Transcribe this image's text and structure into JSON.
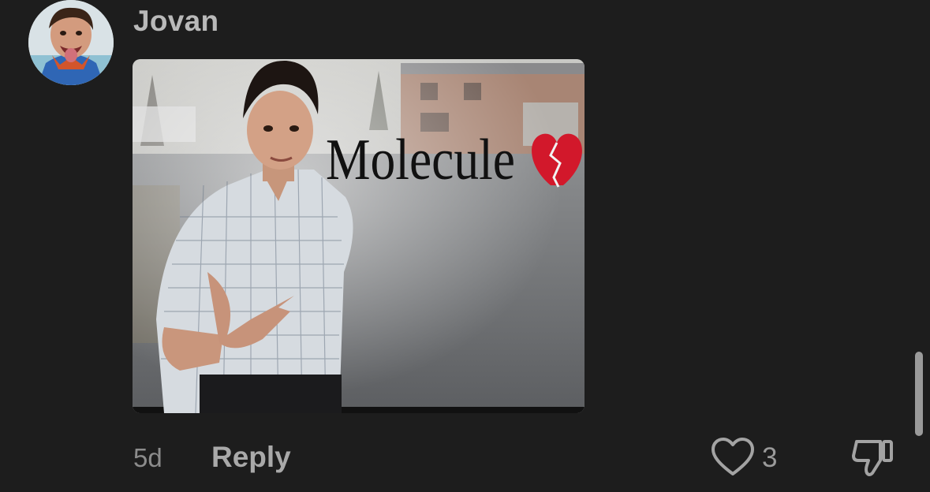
{
  "comment": {
    "username": "Jovan",
    "avatar_icon": "profile-avatar",
    "attachment": {
      "caption": "Molecule",
      "caption_emoji": "💔"
    },
    "timestamp": "5d",
    "reply_label": "Reply",
    "like_icon": "heart-outline-icon",
    "like_count": "3",
    "dislike_icon": "thumbs-down-icon"
  },
  "colors": {
    "background": "#1d1d1d",
    "username": "#b9b9b9",
    "meta_text": "#8c8c8c",
    "action_text": "#a9a9a9",
    "heart_emoji": "#d2182b"
  }
}
